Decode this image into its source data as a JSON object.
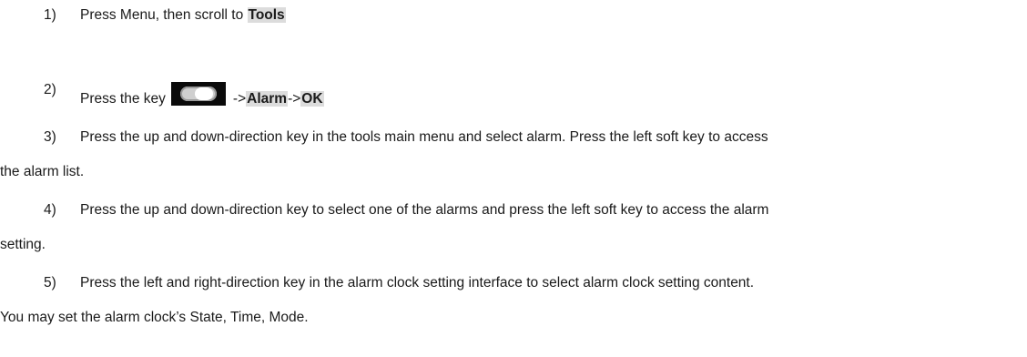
{
  "steps": [
    {
      "num": "1)",
      "pre": "Press Menu, then scroll to ",
      "hl1": "Tools"
    },
    {
      "num": "2)",
      "pre": "Press the key",
      "arrow1": "->",
      "hl1": "Alarm",
      "arrow2": "->",
      "hl2": "OK",
      "icon": "soft-key-icon"
    },
    {
      "num": "3)",
      "line1": "Press the up and down-direction key in the tools main menu and select alarm. Press the left soft key to access",
      "line2": "the alarm list."
    },
    {
      "num": "4)",
      "line1": "Press the up and down-direction key to select one of the alarms and press the left soft key to access the alarm",
      "line2": "setting."
    },
    {
      "num": "5)",
      "line1": "Press the left and right-direction key in the alarm clock setting interface to select alarm clock setting content.",
      "line2": "You may set the alarm clock’s State, Time, Mode."
    }
  ]
}
